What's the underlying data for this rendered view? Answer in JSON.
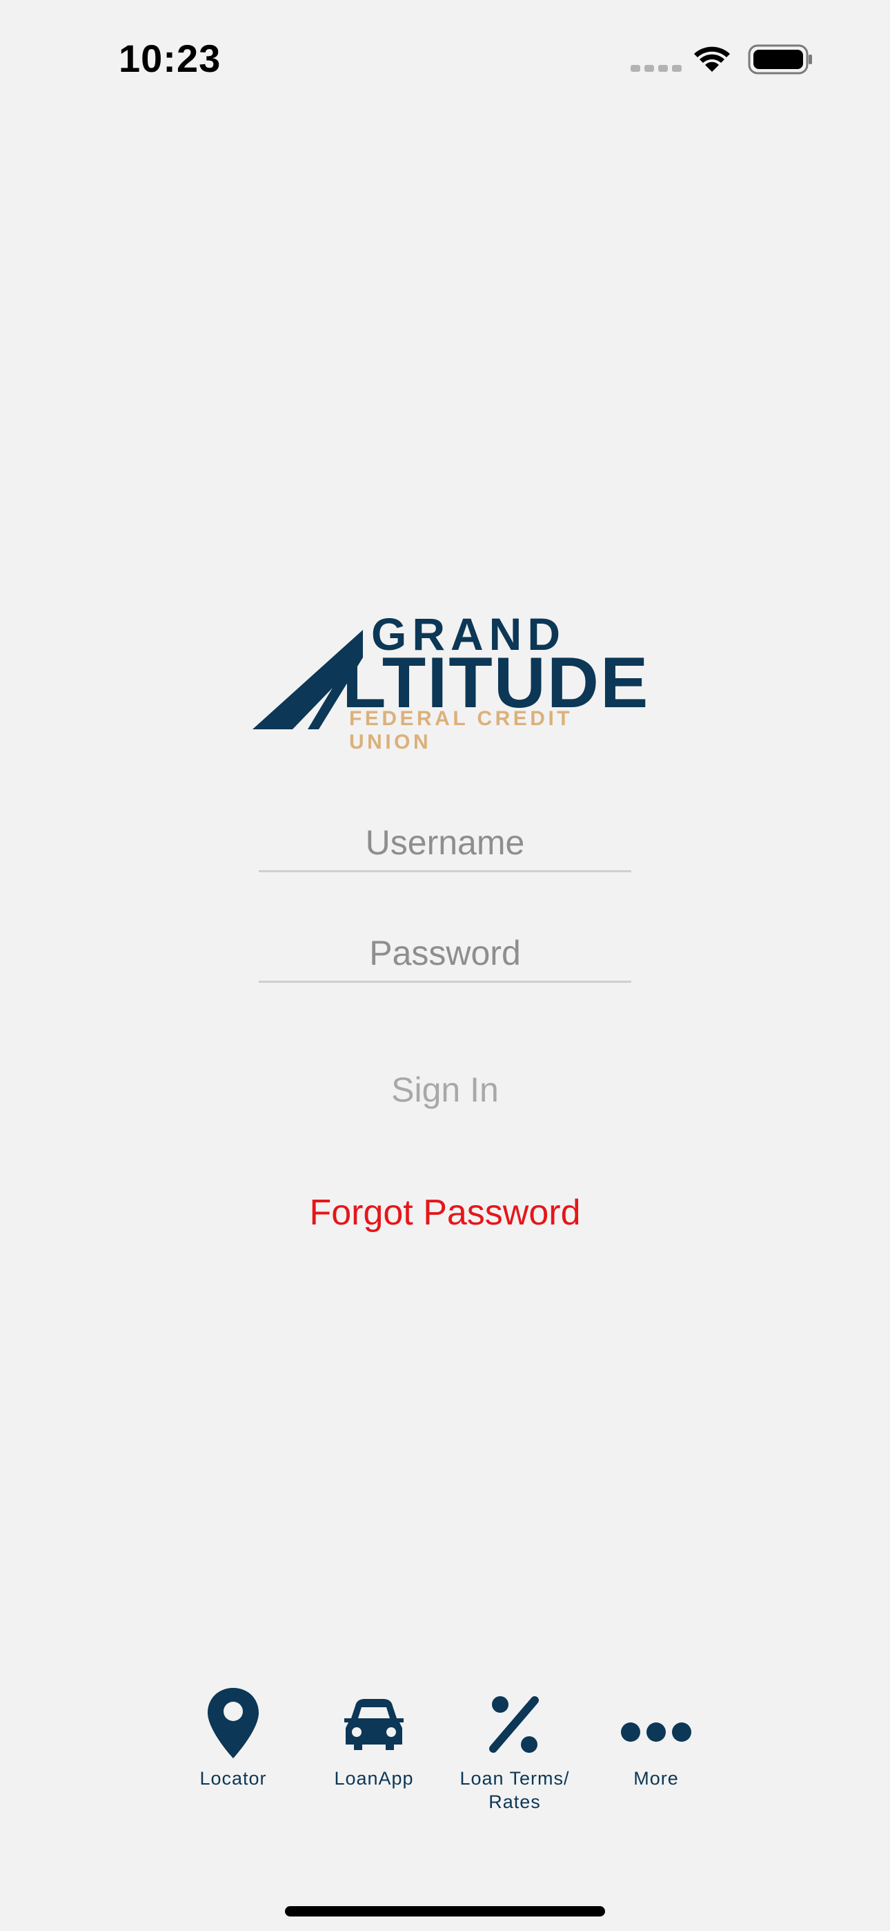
{
  "status_bar": {
    "time": "10:23"
  },
  "brand": {
    "logo_line1": "GRAND",
    "logo_line2": "LTITUDE",
    "logo_line3": "FEDERAL CREDIT UNION",
    "navy": "#0c3756",
    "gold": "#dcb07a"
  },
  "login": {
    "username_placeholder": "Username",
    "password_placeholder": "Password",
    "sign_in_label": "Sign In",
    "forgot_password_label": "Forgot Password",
    "forgot_color": "#e5161a"
  },
  "tabbar": {
    "items": [
      {
        "label": "Locator",
        "icon": "map-pin-icon"
      },
      {
        "label": "LoanApp",
        "icon": "car-icon"
      },
      {
        "label": "Loan Terms/\nRates",
        "icon": "percent-icon"
      },
      {
        "label": "More",
        "icon": "more-dots-icon"
      }
    ]
  }
}
